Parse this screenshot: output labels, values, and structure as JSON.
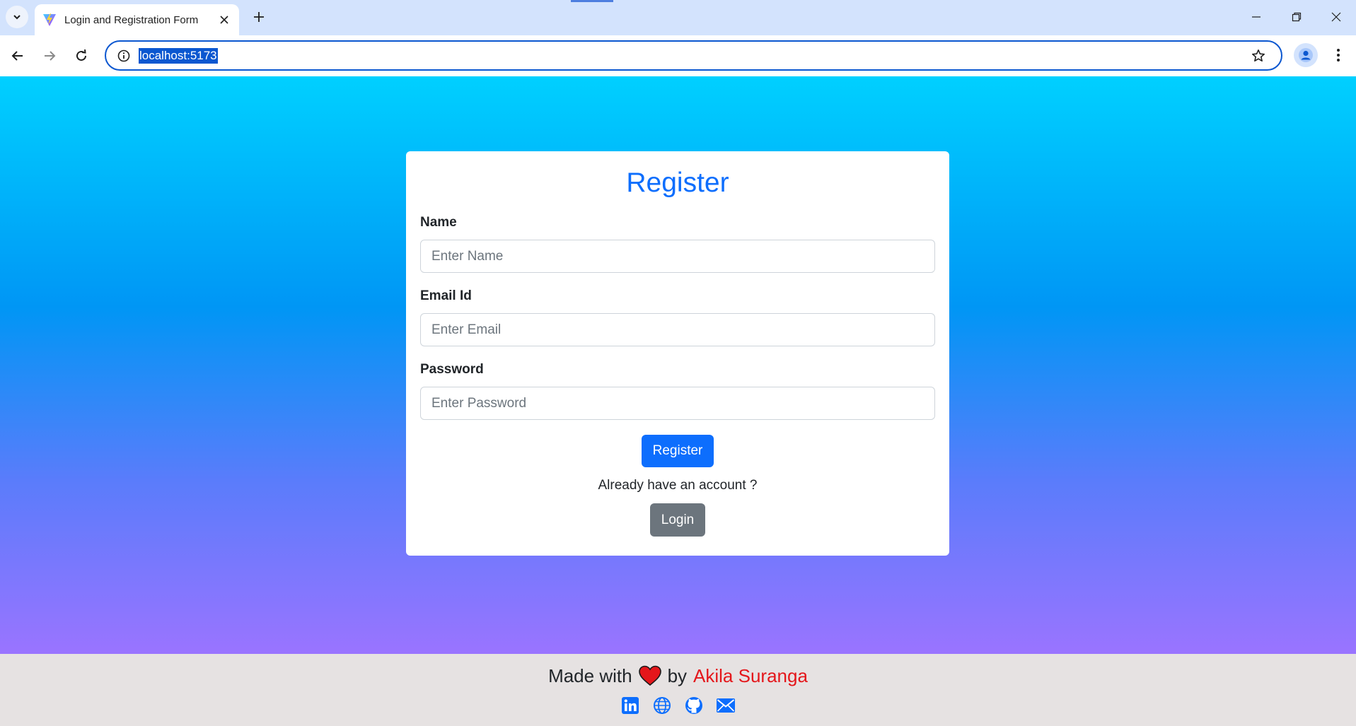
{
  "browser": {
    "tab_title": "Login and Registration Form",
    "url": "localhost:5173"
  },
  "form": {
    "title": "Register",
    "fields": [
      {
        "label": "Name",
        "placeholder": "Enter Name"
      },
      {
        "label": "Email Id",
        "placeholder": "Enter Email"
      },
      {
        "label": "Password",
        "placeholder": "Enter Password"
      }
    ],
    "submit_label": "Register",
    "already_text": "Already have an account ?",
    "login_label": "Login"
  },
  "footer": {
    "made_with": "Made with",
    "by": "by",
    "author": "Akila Suranga",
    "socials": [
      "linkedin-icon",
      "globe-icon",
      "github-icon",
      "mail-icon"
    ]
  },
  "colors": {
    "primary": "#0d6efd",
    "secondary": "#6c757d",
    "author": "#e4171b",
    "heart": "#e4171b"
  }
}
